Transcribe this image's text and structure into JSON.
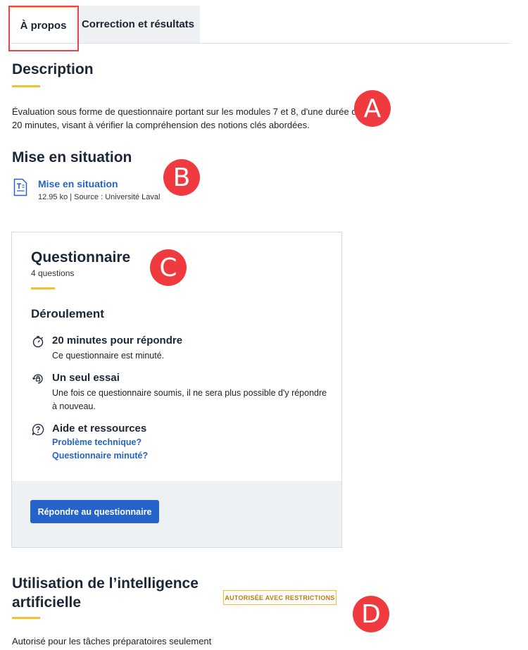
{
  "tabs": [
    {
      "label": "À propos",
      "active": true
    },
    {
      "label": "Correction et résultats",
      "active": false
    }
  ],
  "description": {
    "heading": "Description",
    "text_line1": "Évaluation sous forme de questionnaire portant sur les modules 7 et 8, d'une durée de",
    "text_line2": "20 minutes, visant à vérifier la compréhension des notions clés abordées."
  },
  "mise_en_situation": {
    "heading": "Mise en situation",
    "document": {
      "title": "Mise en situation",
      "meta": "12.95 ko | Source : Université Laval",
      "icon": "text-document-icon"
    }
  },
  "questionnaire": {
    "title": "Questionnaire",
    "subtitle": "4 questions",
    "deroulement_heading": "Déroulement",
    "items": [
      {
        "icon": "stopwatch-icon",
        "title": "20 minutes pour répondre",
        "lines": [
          "Ce questionnaire est minuté."
        ]
      },
      {
        "icon": "single-attempt-icon",
        "title": "Un seul essai",
        "lines": [
          "Une fois ce questionnaire soumis, il ne sera plus possible d'y répondre",
          "à nouveau."
        ]
      },
      {
        "icon": "help-icon",
        "title": "Aide et ressources",
        "links": [
          "Problème technique?",
          "Questionnaire minuté?"
        ]
      }
    ],
    "button_label": "Répondre au questionnaire"
  },
  "ia": {
    "heading_line1": "Utilisation de l’intelligence",
    "heading_line2": "artificielle",
    "badge": "AUTORISÉE AVEC RESTRICTIONS",
    "text": "Autorisé pour les tâches préparatoires seulement"
  },
  "markers": [
    "A",
    "B",
    "C",
    "D"
  ],
  "colors": {
    "accent_yellow": "#f2c230",
    "link_blue": "#2764c4",
    "button_blue": "#2463c9",
    "marker_red": "#ef3a3f",
    "highlight_red": "#e8444f",
    "badge_text": "#b97c14"
  }
}
